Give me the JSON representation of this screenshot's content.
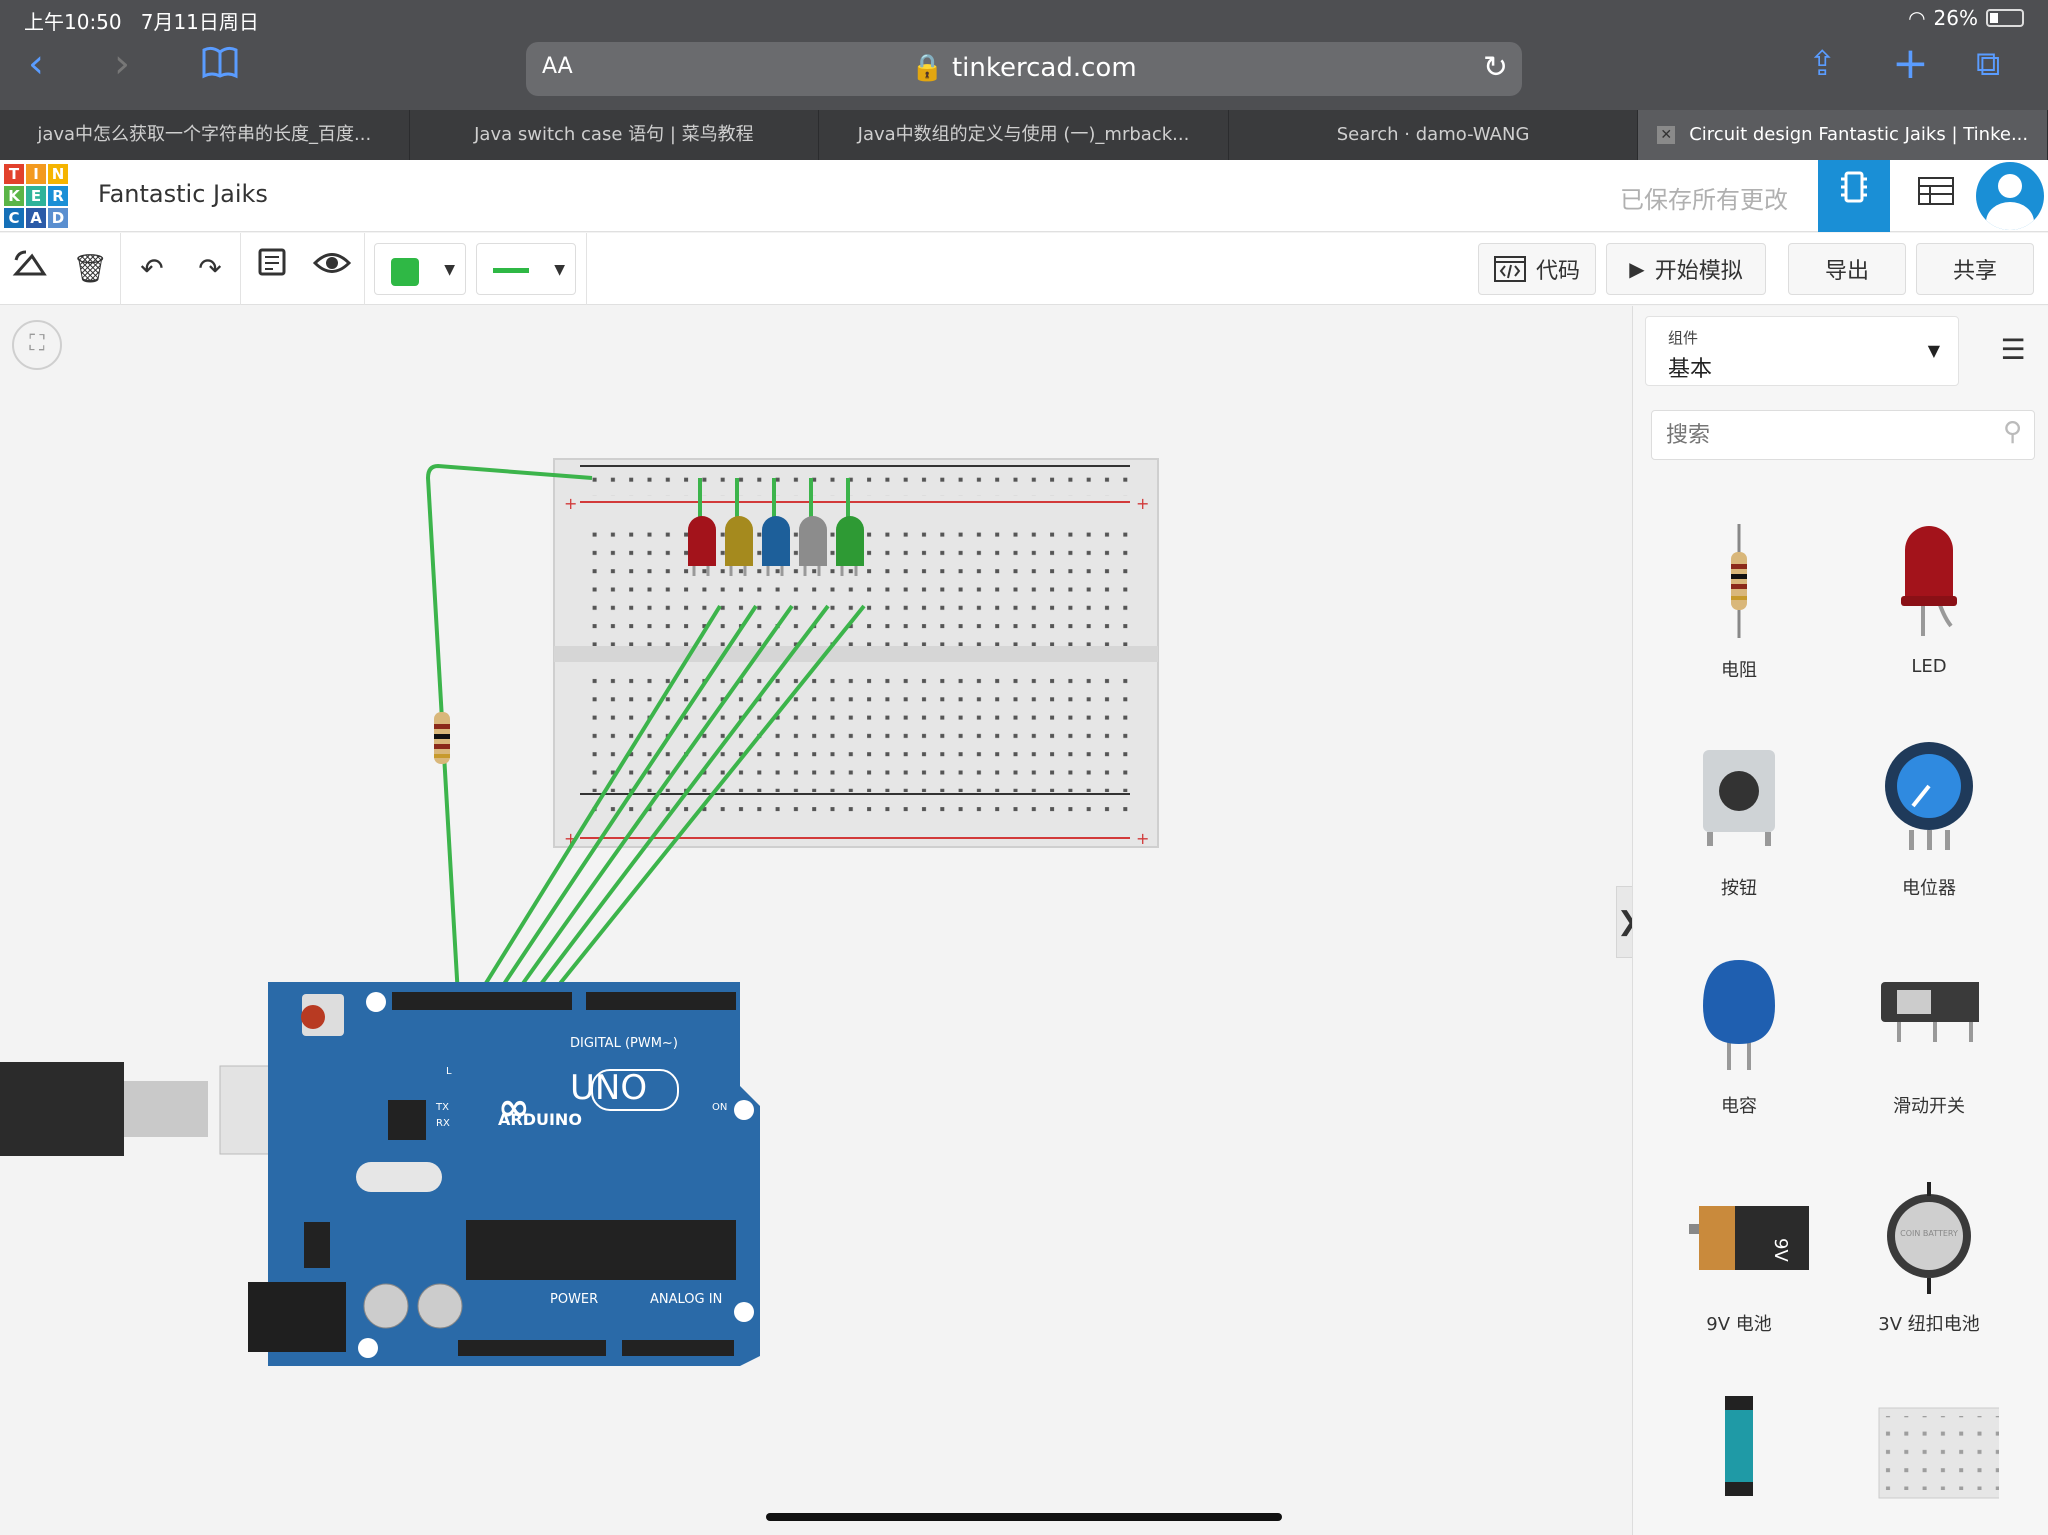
{
  "status_bar": {
    "time": "上午10:50",
    "date": "7月11日周日",
    "wifi": "26%"
  },
  "browser": {
    "aa_label": "AA",
    "url": "tinkercad.com",
    "tabs": [
      {
        "title": "java中怎么获取一个字符串的长度_百度..."
      },
      {
        "title": "Java switch case 语句 | 菜鸟教程"
      },
      {
        "title": "Java中数组的定义与使用 (一)_mrback..."
      },
      {
        "title": "Search · damo-WANG"
      },
      {
        "title": "Circuit design Fantastic Jaiks | Tinke..."
      }
    ]
  },
  "header": {
    "logo_letters": [
      "T",
      "I",
      "N",
      "K",
      "E",
      "R",
      "C",
      "A",
      "D"
    ],
    "project_title": "Fantastic Jaiks",
    "saved_status": "已保存所有更改"
  },
  "toolbar": {
    "code_label": "代码",
    "simulate_label": "开始模拟",
    "export_label": "导出",
    "share_label": "共享"
  },
  "panel": {
    "category_label": "组件",
    "category_value": "基本",
    "search_placeholder": "搜索",
    "components": [
      {
        "label": "电阻"
      },
      {
        "label": "LED"
      },
      {
        "label": "按钮"
      },
      {
        "label": "电位器"
      },
      {
        "label": "电容"
      },
      {
        "label": "滑动开关"
      },
      {
        "label": "9V 电池"
      },
      {
        "label": "3V 纽扣电池"
      }
    ],
    "battery_9v_text": "9V",
    "coin_battery_text": "COIN BATTERY"
  },
  "arduino": {
    "brand": "ARDUINO",
    "model": "UNO",
    "digital_label": "DIGITAL (PWM~)",
    "power_label": "POWER",
    "analog_label": "ANALOG IN",
    "on_label": "ON",
    "tx_label": "TX",
    "rx_label": "RX",
    "l_label": "L"
  },
  "colors": {
    "accent": "#1a8fd6",
    "wire": "#3cb44b",
    "arduino": "#2a6aa8"
  }
}
